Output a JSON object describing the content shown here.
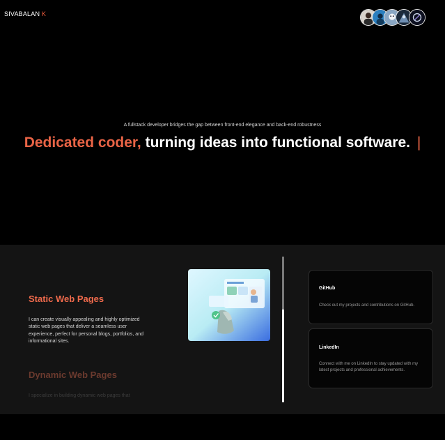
{
  "header": {
    "brand_name": "SIVABALAN",
    "brand_initial": "K",
    "avatars": [
      "avatar-1",
      "avatar-2",
      "avatar-3",
      "avatar-4",
      "avatar-5"
    ]
  },
  "hero": {
    "tagline": "A fullstack developer bridges the gap between front-end elegance and back-end robustness",
    "headline_accent": "Dedicated coder,",
    "headline_main": "turning ideas into functional software.",
    "caret": "|"
  },
  "services": [
    {
      "title": "Static Web Pages",
      "description": "I can create visually appealing and highly optimized static web pages that deliver a seamless user experience, perfect for personal blogs, portfolios, and informational sites."
    },
    {
      "title": "Dynamic Web Pages",
      "description": "I specialize in building dynamic web pages that"
    }
  ],
  "cards": [
    {
      "title": "GitHub",
      "text": "Check out my projects and contributions on GitHub."
    },
    {
      "title": "LinkedIn",
      "text": "Connect with me on LinkedIn to stay updated with my latest projects and professional achievements."
    }
  ],
  "colors": {
    "accent": "#ef5b3c",
    "background": "#000000",
    "section_background": "#141414"
  }
}
